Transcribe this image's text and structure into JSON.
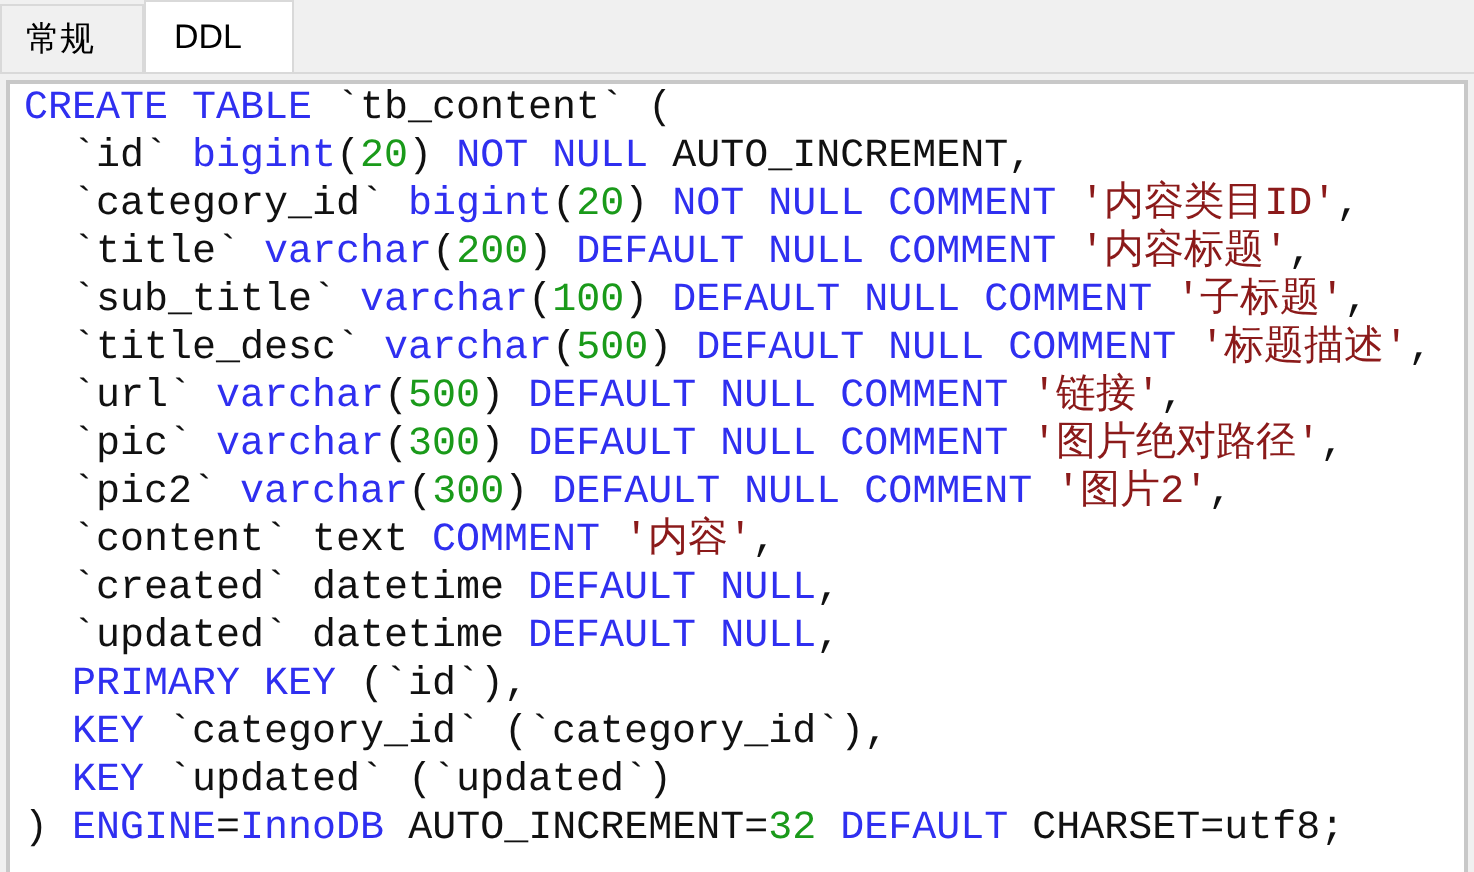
{
  "tabs": [
    {
      "label": "常规",
      "selected": false
    },
    {
      "label": "DDL",
      "selected": true
    }
  ],
  "ddl_lines": [
    [
      {
        "kind": "keyword",
        "text": "CREATE TABLE"
      },
      {
        "kind": "plain",
        "text": " `tb_content` ("
      }
    ],
    [
      {
        "kind": "plain",
        "text": "  `id` "
      },
      {
        "kind": "keyword",
        "text": "bigint"
      },
      {
        "kind": "plain",
        "text": "("
      },
      {
        "kind": "number",
        "text": "20"
      },
      {
        "kind": "plain",
        "text": ") "
      },
      {
        "kind": "keyword",
        "text": "NOT NULL"
      },
      {
        "kind": "plain",
        "text": " AUTO_INCREMENT,"
      }
    ],
    [
      {
        "kind": "plain",
        "text": "  `category_id` "
      },
      {
        "kind": "keyword",
        "text": "bigint"
      },
      {
        "kind": "plain",
        "text": "("
      },
      {
        "kind": "number",
        "text": "20"
      },
      {
        "kind": "plain",
        "text": ") "
      },
      {
        "kind": "keyword",
        "text": "NOT NULL COMMENT"
      },
      {
        "kind": "string",
        "text": " '内容类目ID'"
      },
      {
        "kind": "plain",
        "text": ","
      }
    ],
    [
      {
        "kind": "plain",
        "text": "  `title` "
      },
      {
        "kind": "keyword",
        "text": "varchar"
      },
      {
        "kind": "plain",
        "text": "("
      },
      {
        "kind": "number",
        "text": "200"
      },
      {
        "kind": "plain",
        "text": ") "
      },
      {
        "kind": "keyword",
        "text": "DEFAULT NULL COMMENT"
      },
      {
        "kind": "string",
        "text": " '内容标题'"
      },
      {
        "kind": "plain",
        "text": ","
      }
    ],
    [
      {
        "kind": "plain",
        "text": "  `sub_title` "
      },
      {
        "kind": "keyword",
        "text": "varchar"
      },
      {
        "kind": "plain",
        "text": "("
      },
      {
        "kind": "number",
        "text": "100"
      },
      {
        "kind": "plain",
        "text": ") "
      },
      {
        "kind": "keyword",
        "text": "DEFAULT NULL COMMENT"
      },
      {
        "kind": "string",
        "text": " '子标题'"
      },
      {
        "kind": "plain",
        "text": ","
      }
    ],
    [
      {
        "kind": "plain",
        "text": "  `title_desc` "
      },
      {
        "kind": "keyword",
        "text": "varchar"
      },
      {
        "kind": "plain",
        "text": "("
      },
      {
        "kind": "number",
        "text": "500"
      },
      {
        "kind": "plain",
        "text": ") "
      },
      {
        "kind": "keyword",
        "text": "DEFAULT NULL COMMENT"
      },
      {
        "kind": "string",
        "text": " '标题描述'"
      },
      {
        "kind": "plain",
        "text": ","
      }
    ],
    [
      {
        "kind": "plain",
        "text": "  `url` "
      },
      {
        "kind": "keyword",
        "text": "varchar"
      },
      {
        "kind": "plain",
        "text": "("
      },
      {
        "kind": "number",
        "text": "500"
      },
      {
        "kind": "plain",
        "text": ") "
      },
      {
        "kind": "keyword",
        "text": "DEFAULT NULL COMMENT"
      },
      {
        "kind": "string",
        "text": " '链接'"
      },
      {
        "kind": "plain",
        "text": ","
      }
    ],
    [
      {
        "kind": "plain",
        "text": "  `pic` "
      },
      {
        "kind": "keyword",
        "text": "varchar"
      },
      {
        "kind": "plain",
        "text": "("
      },
      {
        "kind": "number",
        "text": "300"
      },
      {
        "kind": "plain",
        "text": ") "
      },
      {
        "kind": "keyword",
        "text": "DEFAULT NULL COMMENT"
      },
      {
        "kind": "string",
        "text": " '图片绝对路径'"
      },
      {
        "kind": "plain",
        "text": ","
      }
    ],
    [
      {
        "kind": "plain",
        "text": "  `pic2` "
      },
      {
        "kind": "keyword",
        "text": "varchar"
      },
      {
        "kind": "plain",
        "text": "("
      },
      {
        "kind": "number",
        "text": "300"
      },
      {
        "kind": "plain",
        "text": ") "
      },
      {
        "kind": "keyword",
        "text": "DEFAULT NULL COMMENT"
      },
      {
        "kind": "string",
        "text": " '图片2'"
      },
      {
        "kind": "plain",
        "text": ","
      }
    ],
    [
      {
        "kind": "plain",
        "text": "  `content` text "
      },
      {
        "kind": "keyword",
        "text": "COMMENT"
      },
      {
        "kind": "string",
        "text": " '内容'"
      },
      {
        "kind": "plain",
        "text": ","
      }
    ],
    [
      {
        "kind": "plain",
        "text": "  `created` datetime "
      },
      {
        "kind": "keyword",
        "text": "DEFAULT NULL"
      },
      {
        "kind": "plain",
        "text": ","
      }
    ],
    [
      {
        "kind": "plain",
        "text": "  `updated` datetime "
      },
      {
        "kind": "keyword",
        "text": "DEFAULT NULL"
      },
      {
        "kind": "plain",
        "text": ","
      }
    ],
    [
      {
        "kind": "keyword",
        "text": "  PRIMARY KEY"
      },
      {
        "kind": "plain",
        "text": " (`id`),"
      }
    ],
    [
      {
        "kind": "keyword",
        "text": "  KEY"
      },
      {
        "kind": "plain",
        "text": " `category_id` (`category_id`),"
      }
    ],
    [
      {
        "kind": "keyword",
        "text": "  KEY"
      },
      {
        "kind": "plain",
        "text": " `updated` (`updated`)"
      }
    ],
    [
      {
        "kind": "plain",
        "text": ") "
      },
      {
        "kind": "keyword",
        "text": "ENGINE"
      },
      {
        "kind": "plain",
        "text": "="
      },
      {
        "kind": "keyword",
        "text": "InnoDB"
      },
      {
        "kind": "plain",
        "text": " AUTO_INCREMENT="
      },
      {
        "kind": "number",
        "text": "32"
      },
      {
        "kind": "keyword",
        "text": " DEFAULT"
      },
      {
        "kind": "plain",
        "text": " CHARSET=utf8;"
      }
    ]
  ]
}
